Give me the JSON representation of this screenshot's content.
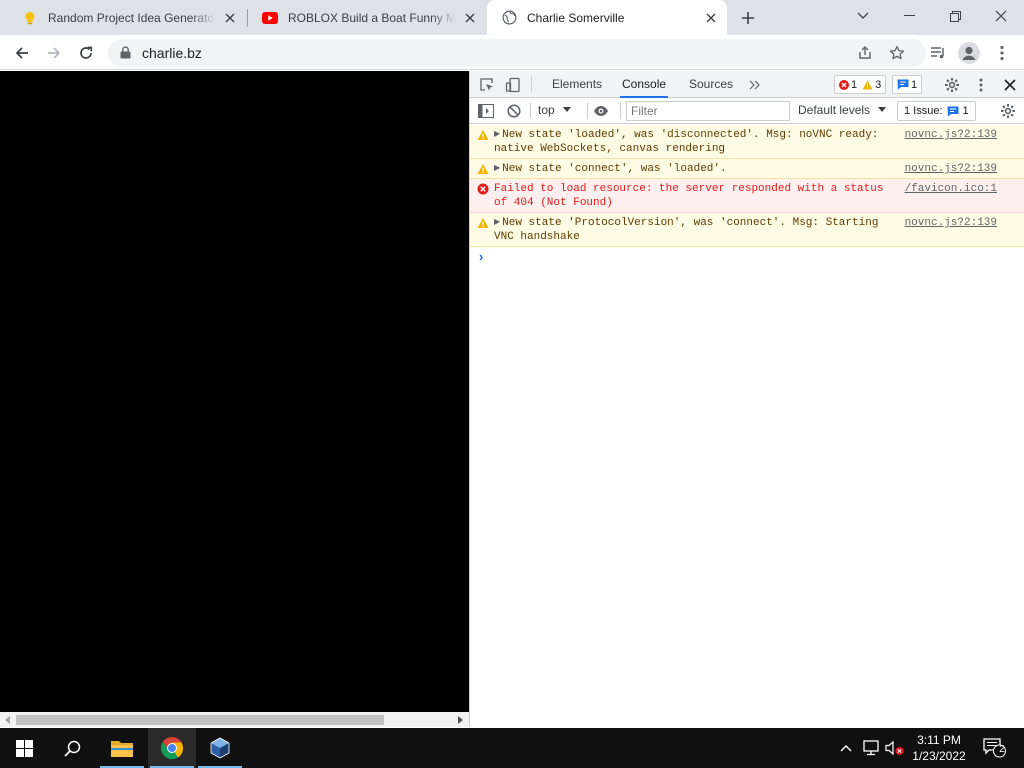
{
  "browser": {
    "tabs": [
      {
        "title": "Random Project Idea Generator",
        "active": false
      },
      {
        "title": "ROBLOX Build a Boat Funny Mon",
        "active": false
      },
      {
        "title": "Charlie Somerville",
        "active": true
      }
    ],
    "url": "charlie.bz"
  },
  "devtools": {
    "tabs": [
      "Elements",
      "Console",
      "Sources"
    ],
    "active_tab": "Console",
    "error_count": "1",
    "warning_count": "3",
    "message_count": "1",
    "context": "top",
    "filter_placeholder": "Filter",
    "levels_label": "Default levels",
    "issues_label": "1 Issue:",
    "issues_count": "1",
    "messages": [
      {
        "level": "warning",
        "text": "New state 'loaded', was 'disconnected'. Msg: noVNC ready: native WebSockets, canvas rendering",
        "source": "novnc.js?2:139",
        "expandable": true
      },
      {
        "level": "warning",
        "text": "New state 'connect', was 'loaded'.",
        "source": "novnc.js?2:139",
        "expandable": true
      },
      {
        "level": "error",
        "text": "Failed to load resource: the server responded with a status of 404 (Not Found)",
        "source": "/favicon.ico:1",
        "expandable": false
      },
      {
        "level": "warning",
        "text": "New state 'ProtocolVersion', was 'connect'. Msg: Starting VNC handshake",
        "source": "novnc.js?2:139",
        "expandable": true
      }
    ]
  },
  "taskbar": {
    "time": "3:11 PM",
    "date": "1/23/2022",
    "notification_count": "2"
  },
  "colors": {
    "accent": "#1a73e8",
    "warning_bg": "#fffbe5",
    "error_bg": "#fff0f0",
    "error_text": "#e41b1b"
  }
}
